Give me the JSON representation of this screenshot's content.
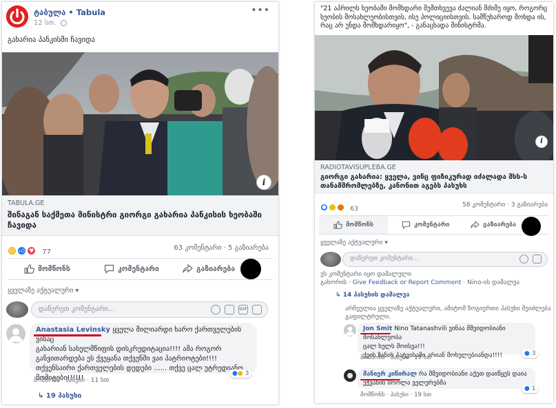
{
  "left": {
    "page_name": "ტაბულა • Tabula",
    "post_time": "12 სთ.",
    "post_text": "გახარია პანკისში ჩავიდა",
    "link_domain": "TABULA.GE",
    "link_title": "შინაგან საქმეთა მინისტრი გიორგი გახარია პანკისის ხეობაში ჩავიდა",
    "reaction_count": "77",
    "comment_count": "63 კომენტარი",
    "share_count": "5 გაზიარება",
    "actions": {
      "like": "მომწონს",
      "comment": "კომენტარი",
      "share": "გაზიარება"
    },
    "sort_label": "ყველაზე აქტუალური ▾",
    "comment_placeholder": "დაწერეთ კომენტარი...",
    "comment": {
      "author": "Anastasia Levinsky",
      "text_1": "ყველა მილიარდი ხარო ქართველების ვისაც",
      "text_2": "გახარიან სახელმწიფის დისკრედიტაცია!!!! ამა როგორ",
      "text_3": "განვითარდება ეს ქვეყანა თქვენში ვაი პატრიოტები!!!!",
      "text_4": "თქვენსაირი ქართველების დედები ...... თქვე ცალ უტრედიანო",
      "text_5": "მოშიტები!!!!!!",
      "like": "მომწონს",
      "reply": "პასუხი",
      "time": "11 სთ",
      "reactions": "3"
    },
    "replies": "19 პასუხი"
  },
  "right": {
    "quote_1": "\"21 აპრილს ხეობაში მომხდარი შემთხვევა ძალიან მძიმე იყო, როგორც",
    "quote_2": "ხეობის მოსახლეობისთვის, ისე პოლიციისთვის. სამწუხაროდ მოხდა ის,",
    "quote_3": "რაც არ უნდა მომხდარიყო\", - განაცხადა მინისტრმა.",
    "link_domain": "RADIOTAVISUPLEBA.GE",
    "link_title_1": "გიორგი გახარია: ყველა, ვინც ფიზიკურად იძალადა შსს-ს",
    "link_title_2": "თანამშრომლებზე, კანონით აგებს პასუხს",
    "reaction_count": "63",
    "comment_count": "58 კომენტარი",
    "share_count": "3 გაზიარება",
    "actions": {
      "like": "მომწონს",
      "comment": "კომენტარი",
      "share": "გაზიარება"
    },
    "sort_label": "ყველაზე აქტუალური ▾",
    "comment_placeholder": "დაწერეთ კომენტარი...",
    "notice_1": "ეს კომენტარი იყო დამალული",
    "notice_2_a": "გახორის · ",
    "notice_2_link": "Give Feedback or Report Comment",
    "notice_2_b": " · Nino-ის დამალვა",
    "replies_label": "14 პასუხის დამალვა",
    "sorted_note_1": "არჩეულია ყველაზე აქტუალური, ამიტომ ზოგიერთი პასუხი შეიძლება",
    "sorted_note_2": "გაფილტრული.",
    "reply1": {
      "author": "Jon Smit",
      "mention": "Nino Tatanashvili",
      "text_1": "ვინაა მშვიდობიანი მოსახლეობა",
      "text_2": "ცალ ხელს მოისვა!!!",
      "text_3": "ქვის ზანის პატვისაში არიან მოხულებიანდა!!!!",
      "like": "მომწონს",
      "reply": "პასუხი",
      "time": "19 სთ",
      "reactions": "3"
    },
    "reply2": {
      "author": "მანიერ კიწირალ",
      "text_1": "რა მშვიდობიანი აქეთ დაიწყეს დაია",
      "text_2": "ეჭვანის სროლა ველურებმა",
      "like": "მომწონს",
      "reply": "პასუხი",
      "time": "19 სთ",
      "reactions": "1"
    }
  }
}
